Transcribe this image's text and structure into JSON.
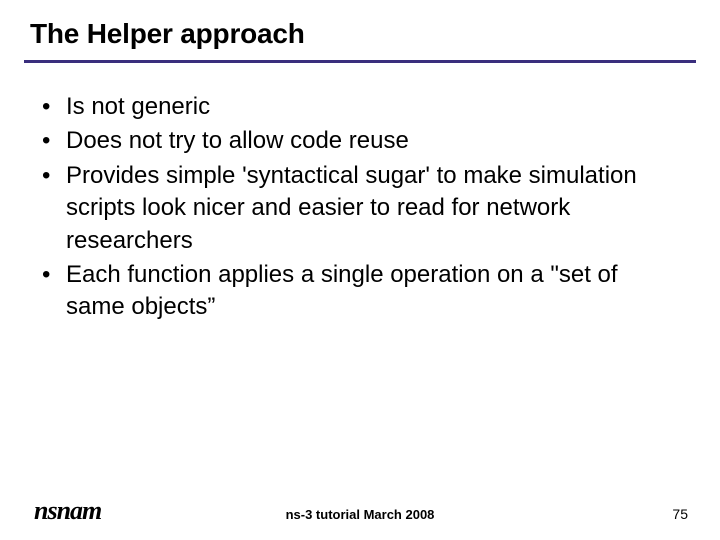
{
  "title": "The Helper approach",
  "bullets": [
    "Is not generic",
    "Does not try to allow code reuse",
    "Provides simple 'syntactical sugar' to make simulation scripts look nicer and easier to read for network researchers",
    "Each function applies a single operation on a \"set of same objects”"
  ],
  "footer": {
    "logo": "nsnam",
    "center": "ns-3 tutorial March 2008",
    "page": "75"
  },
  "colors": {
    "rule": "#3a2e7d"
  }
}
